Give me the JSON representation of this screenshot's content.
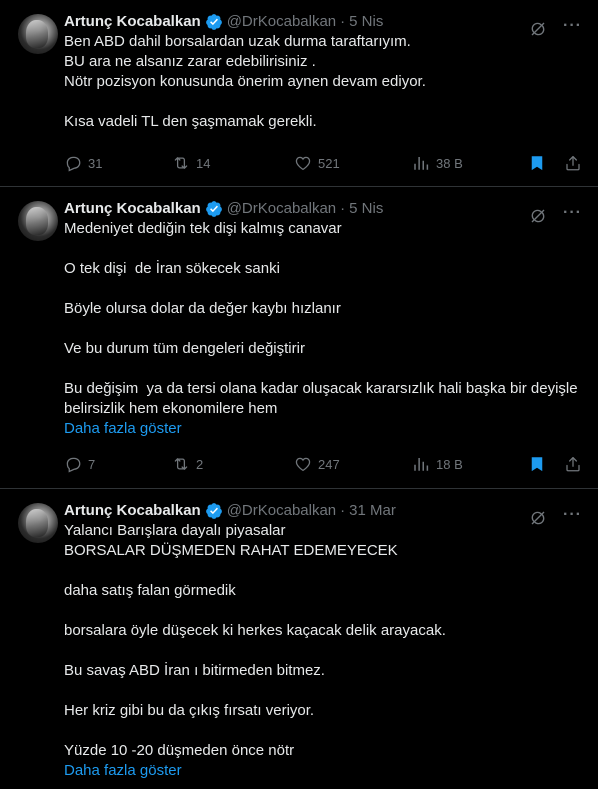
{
  "tweets": [
    {
      "author": "Artunç Kocabalkan",
      "handle": "@DrKocabalkan",
      "dot": "·",
      "date": "5 Nis",
      "text": "Ben ABD dahil borsalardan uzak durma taraftarıyım.\nBU ara ne alsanız zarar edebilirisiniz .\nNötr pozisyon konusunda önerim aynen devam ediyor.\n\nKısa vadeli TL den şaşmamak gerekli.",
      "show_more": "",
      "replies": "31",
      "retweets": "14",
      "likes": "521",
      "views": "38 B"
    },
    {
      "author": "Artunç Kocabalkan",
      "handle": "@DrKocabalkan",
      "dot": "·",
      "date": "5 Nis",
      "text": "Medeniyet dediğin tek dişi kalmış canavar\n\nO tek dişi  de İran sökecek sanki\n\nBöyle olursa dolar da değer kaybı hızlanır\n\nVe bu durum tüm dengeleri değiştirir\n\nBu değişim  ya da tersi olana kadar oluşacak kararsızlık hali başka bir deyişle belirsizlik hem ekonomilere hem",
      "show_more": "Daha fazla göster",
      "replies": "7",
      "retweets": "2",
      "likes": "247",
      "views": "18 B"
    },
    {
      "author": "Artunç Kocabalkan",
      "handle": "@DrKocabalkan",
      "dot": "·",
      "date": "31 Mar",
      "text": "Yalancı Barışlara dayalı piyasalar\nBORSALAR DÜŞMEDEN RAHAT EDEMEYECEK\n\ndaha satış falan görmedik\n\nborsalara öyle düşecek ki herkes kaçacak delik arayacak.\n\nBu savaş ABD İran ı bitirmeden bitmez.\n\nHer kriz gibi bu da çıkış fırsatı veriyor.\n\nYüzde 10 -20 düşmeden önce nötr",
      "show_more": "Daha fazla göster"
    }
  ],
  "colors": {
    "accent": "#1d9bf0",
    "muted": "#71767b",
    "text": "#e7e9ea",
    "border": "#2f3336"
  },
  "icons": [
    "verified-badge-icon",
    "grok-icon",
    "more-icon",
    "reply-icon",
    "retweet-icon",
    "like-icon",
    "views-icon",
    "bookmark-icon",
    "share-icon"
  ]
}
